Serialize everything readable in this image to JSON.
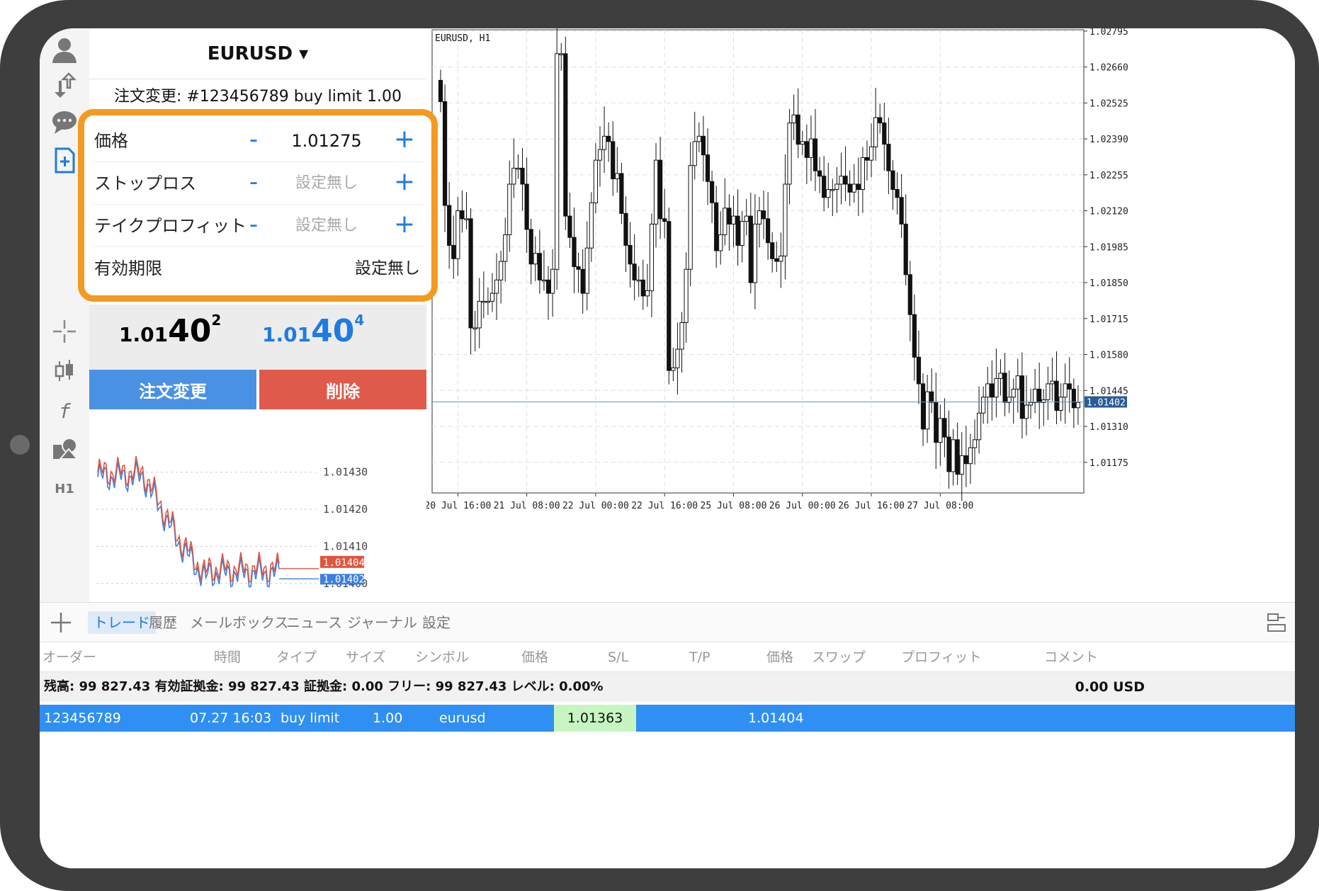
{
  "header": {
    "symbol_title": "EURUSD ▾",
    "order_title": "注文変更: #123456789 buy limit 1.00"
  },
  "popup": {
    "rows": [
      {
        "label": "価格",
        "minus": "-",
        "value": "1.01275",
        "plus": "+"
      },
      {
        "label": "ストップロス",
        "minus": "-",
        "value": "設定無し",
        "plus": "+"
      },
      {
        "label": "テイクプロフィット",
        "minus": "-",
        "value": "設定無し",
        "plus": "+"
      },
      {
        "label": "有効期限",
        "value": "設定無し"
      }
    ],
    "accent_color": "#f49a22"
  },
  "quotes": {
    "bid": {
      "prefix": "1.01",
      "big": "40",
      "sup": "2",
      "color": "#111111"
    },
    "ask": {
      "prefix": "1.01",
      "big": "40",
      "sup": "4",
      "color": "#1e7be0"
    }
  },
  "buttons": {
    "modify_label": "注文変更",
    "delete_label": "削除",
    "modify_color": "#4b91e3",
    "delete_color": "#e05a4c"
  },
  "rail": {
    "icons": [
      "account-icon",
      "trade-arrows-icon",
      "chat-icon",
      "new-order-icon",
      "crosshair-icon",
      "candle-type-icon",
      "indicator-f-icon",
      "objects-icon"
    ],
    "timeframe": "H1"
  },
  "mini_chart": {
    "y_ticks": [
      "1.01430",
      "1.01420",
      "1.01410",
      "1.01400"
    ],
    "ask_tag": "1.01404",
    "bid_tag": "1.01402"
  },
  "chart_data": {
    "type": "candlestick",
    "title": "EURUSD, H1",
    "x_ticks": [
      "20 Jul 16:00",
      "21 Jul 08:00",
      "22 Jul 00:00",
      "22 Jul 16:00",
      "25 Jul 08:00",
      "26 Jul 00:00",
      "26 Jul 16:00",
      "27 Jul 08:00"
    ],
    "y_ticks": [
      "1.02795",
      "1.02660",
      "1.02525",
      "1.02390",
      "1.02255",
      "1.02120",
      "1.01985",
      "1.01850",
      "1.01715",
      "1.01580",
      "1.01445",
      "1.01310",
      "1.01175"
    ],
    "ylim": [
      1.0106,
      1.028
    ],
    "current_price": "1.01402",
    "closes": [
      1.0253,
      1.0214,
      1.0199,
      1.0194,
      1.0212,
      1.0209,
      1.0209,
      1.0168,
      1.0168,
      1.0178,
      1.0178,
      1.0178,
      1.0181,
      1.0186,
      1.0193,
      1.0203,
      1.0222,
      1.0228,
      1.0228,
      1.0222,
      1.0205,
      1.0192,
      1.0196,
      1.0186,
      1.0186,
      1.0181,
      1.019,
      1.0271,
      1.0271,
      1.021,
      1.0202,
      1.0191,
      1.019,
      1.0181,
      1.0198,
      1.0215,
      1.0231,
      1.0235,
      1.024,
      1.0238,
      1.0224,
      1.0226,
      1.0211,
      1.0199,
      1.0192,
      1.0186,
      1.0186,
      1.018,
      1.0182,
      1.0207,
      1.0231,
      1.0209,
      1.0208,
      1.0152,
      1.0153,
      1.016,
      1.017,
      1.019,
      1.0229,
      1.0238,
      1.024,
      1.0233,
      1.0223,
      1.0215,
      1.0197,
      1.0203,
      1.0213,
      1.0207,
      1.021,
      1.0199,
      1.0208,
      1.021,
      1.0185,
      1.0207,
      1.0212,
      1.0209,
      1.02,
      1.0194,
      1.0193,
      1.0195,
      1.0222,
      1.0245,
      1.0248,
      1.0237,
      1.0238,
      1.0232,
      1.0239,
      1.0227,
      1.0225,
      1.0217,
      1.022,
      1.022,
      1.0222,
      1.0225,
      1.0222,
      1.0219,
      1.0222,
      1.022,
      1.0232,
      1.0231,
      1.0236,
      1.0247,
      1.0245,
      1.0237,
      1.0227,
      1.022,
      1.0217,
      1.0207,
      1.0188,
      1.0173,
      1.0157,
      1.0147,
      1.013,
      1.0144,
      1.014,
      1.0125,
      1.0134,
      1.0127,
      1.0114,
      1.0126,
      1.0113,
      1.012,
      1.0117,
      1.0123,
      1.0126,
      1.0136,
      1.0142,
      1.0147,
      1.0142,
      1.0149,
      1.0151,
      1.014,
      1.0142,
      1.0145,
      1.015,
      1.0134,
      1.0139,
      1.014,
      1.0145,
      1.014,
      1.0141,
      1.0147,
      1.0148,
      1.0137,
      1.0142,
      1.0147,
      1.0145,
      1.0138,
      1.014
    ]
  },
  "bottom": {
    "tabs": [
      "トレード",
      "履歴",
      "メールボックス",
      "ニュース",
      "ジャーナル",
      "設定"
    ],
    "columns": [
      "オーダー",
      "時間",
      "タイプ",
      "サイズ",
      "シンボル",
      "価格",
      "S/L",
      "T/P",
      "価格",
      "スワップ",
      "プロフィット",
      "コメント"
    ],
    "balance_text": "残高: 99 827.43 有効証拠金: 99 827.43 証拠金: 0.00 フリー: 99 827.43 レベル: 0.00%",
    "balance_amount": "0.00  USD",
    "order": {
      "id": "123456789",
      "time": "07.27 16:03",
      "type": "buy limit",
      "size": "1.00",
      "symbol": "eurusd",
      "price": "1.01363",
      "current_price": "1.01404"
    }
  }
}
